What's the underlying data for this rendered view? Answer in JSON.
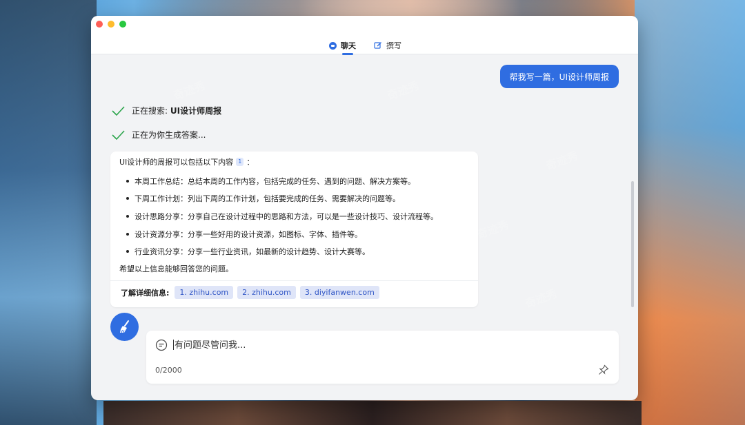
{
  "tabs": [
    {
      "label": "聊天",
      "icon": "chat-bubble-icon",
      "active": true
    },
    {
      "label": "撰写",
      "icon": "edit-icon",
      "active": false
    }
  ],
  "user_message": "帮我写一篇，UI设计师周报",
  "status": [
    {
      "prefix": "正在搜索: ",
      "bold": "UI设计师周报"
    },
    {
      "prefix": "正在为你生成答案...",
      "bold": ""
    }
  ],
  "answer": {
    "intro": "UI设计师的周报可以包括以下内容",
    "ref_badge": "1",
    "intro_suffix": "：",
    "items": [
      "本周工作总结：总结本周的工作内容，包括完成的任务、遇到的问题、解决方案等。",
      "下周工作计划：列出下周的工作计划，包括要完成的任务、需要解决的问题等。",
      "设计思路分享：分享自己在设计过程中的思路和方法，可以是一些设计技巧、设计流程等。",
      "设计资源分享：分享一些好用的设计资源，如图标、字体、插件等。",
      "行业资讯分享：分享一些行业资讯，如最新的设计趋势、设计大赛等。"
    ],
    "closing": "希望以上信息能够回答您的问题。",
    "refs_label": "了解详细信息:",
    "refs": [
      "1. zhihu.com",
      "2. zhihu.com",
      "3. diyifanwen.com"
    ]
  },
  "composer": {
    "placeholder": "有问题尽管问我...",
    "counter": "0/2000"
  },
  "watermark": "奇迹秀",
  "colors": {
    "accent": "#2f6de1",
    "check": "#2aa44a",
    "chip_bg": "#dfe5f8"
  }
}
